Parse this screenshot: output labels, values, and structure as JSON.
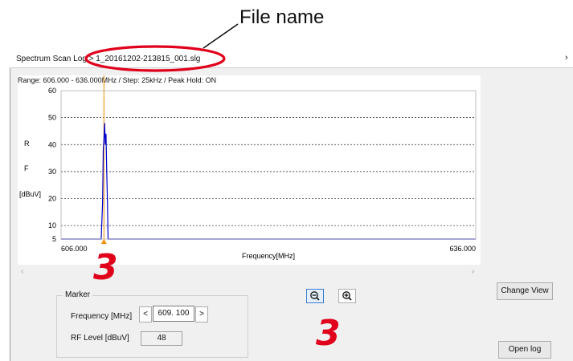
{
  "callout": {
    "label": "File name"
  },
  "window": {
    "breadcrumb": "Spectrum Scan Log > 1_20161202-213815_001.slg",
    "close_glyph": "›"
  },
  "chart": {
    "range_text": "Range: 606.000 - 636.000MHz / Step: 25kHz / Peak Hold: ON"
  },
  "chart_data": {
    "type": "line",
    "title": "",
    "xlabel": "Frequency[MHz]",
    "ylabel": [
      "R",
      "F",
      "[dBuV]"
    ],
    "xlim": [
      606.0,
      636.0
    ],
    "ylim": [
      5,
      60
    ],
    "x_tick_labels": [
      "606.000",
      "636.000"
    ],
    "y_ticks": [
      5,
      10,
      20,
      30,
      40,
      50,
      60
    ],
    "grid": "dashed horizontal",
    "marker_x": 609.1,
    "series": [
      {
        "color": "#0000cc",
        "x": [
          606.0,
          608.9,
          609.0,
          609.05,
          609.1,
          609.15,
          609.2,
          609.25,
          609.3,
          609.35,
          609.4,
          636.0
        ],
        "y": [
          5,
          5,
          18,
          38,
          42,
          48,
          40,
          44,
          30,
          20,
          5,
          5
        ]
      }
    ]
  },
  "marker": {
    "legend": "Marker",
    "frequency_label": "Frequency [MHz]",
    "frequency_value": "609. 100",
    "left_btn": "<",
    "right_btn": ">",
    "rf_label": "RF Level [dBuV]",
    "rf_value": "48"
  },
  "buttons": {
    "change_view": "Change View",
    "open_log": "Open log"
  },
  "annotations": {
    "num_left": "3",
    "num_bottom": "3"
  },
  "colors": {
    "trace": "#0000cc",
    "marker": "#f08c00",
    "callout": "#e0001b"
  }
}
